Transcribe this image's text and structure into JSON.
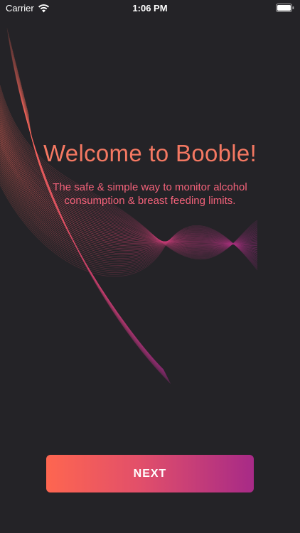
{
  "status_bar": {
    "carrier": "Carrier",
    "time": "1:06 PM",
    "wifi_icon": "wifi-icon",
    "battery_icon": "battery-full-icon"
  },
  "welcome": {
    "title": "Welcome to Booble!",
    "subtitle": "The safe & simple way to monitor alcohol consumption & breast feeding limits."
  },
  "actions": {
    "next_label": "NEXT"
  },
  "colors": {
    "background": "#242327",
    "title": "#f47862",
    "subtitle": "#f3627a",
    "button_gradient_start": "#fe6650",
    "button_gradient_end": "#a72a87"
  }
}
